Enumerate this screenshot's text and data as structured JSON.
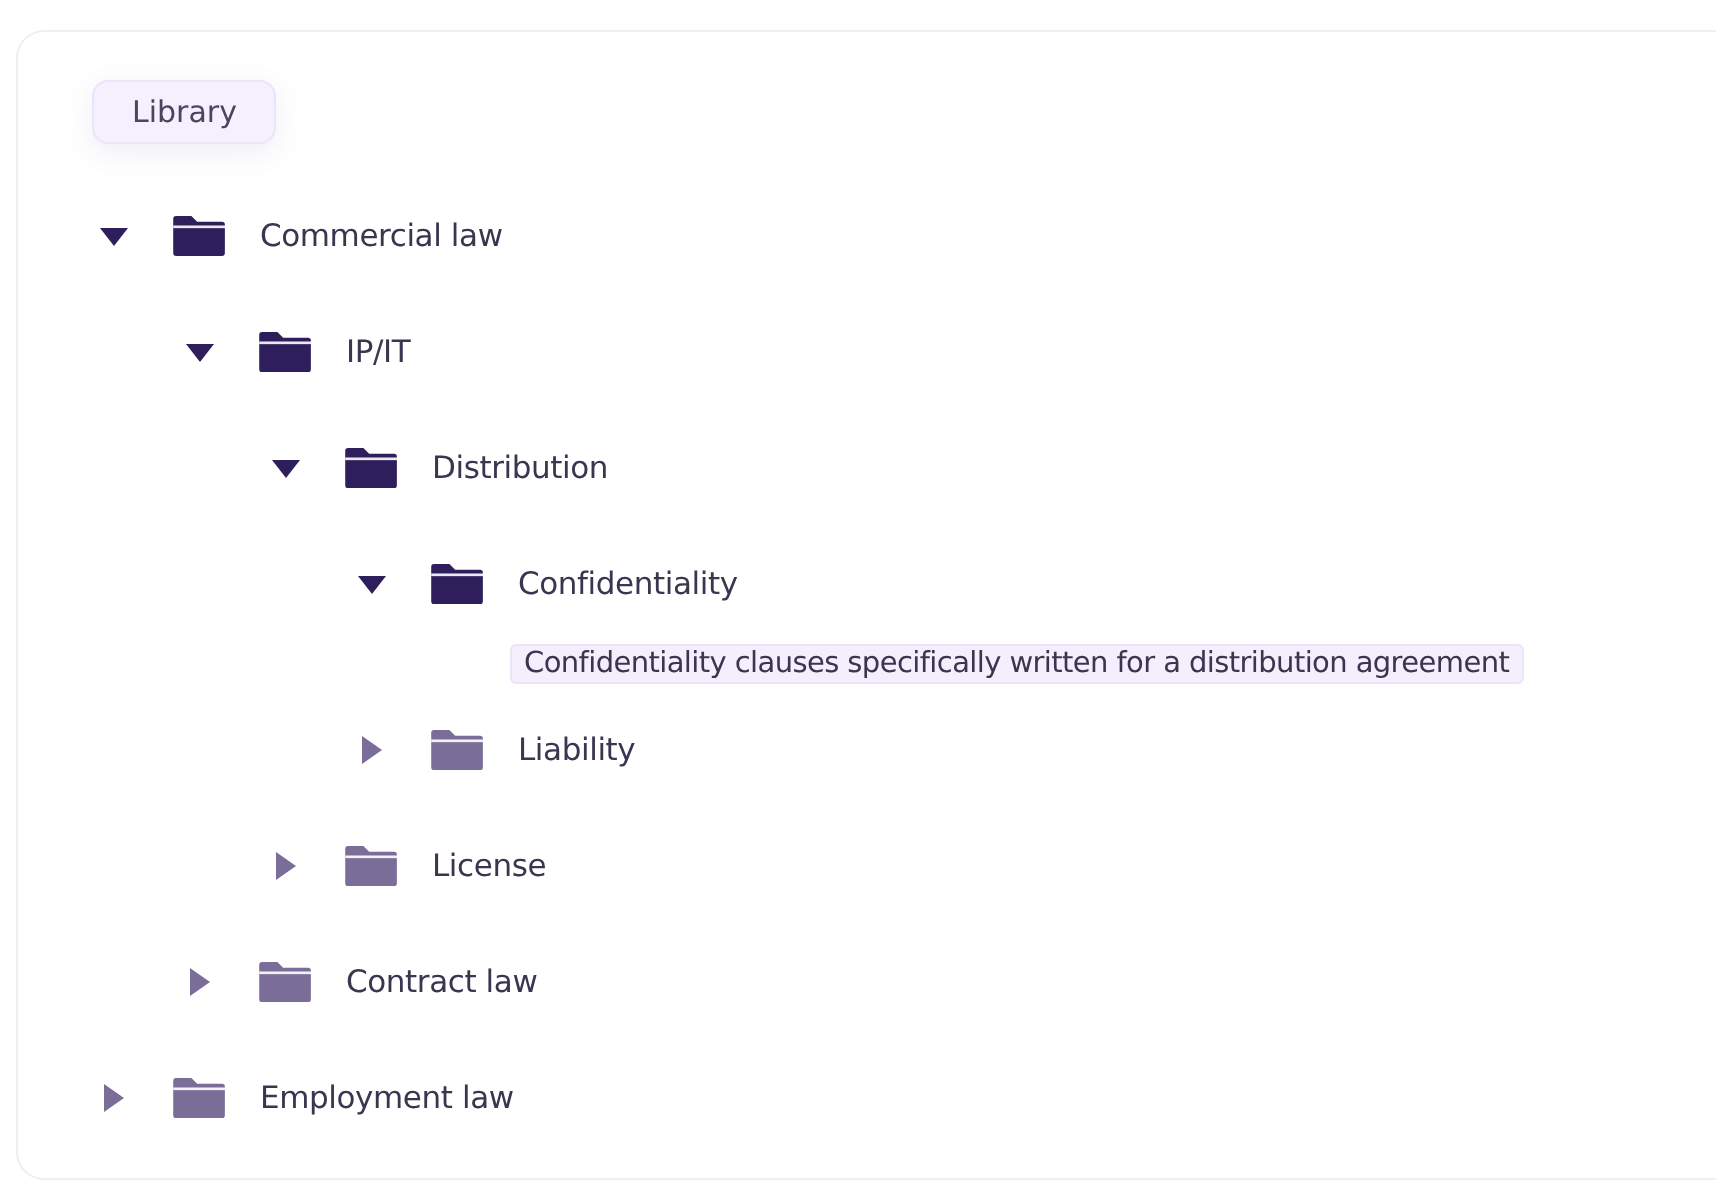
{
  "library_tab": {
    "label": "Library",
    "selected": true
  },
  "tree": [
    {
      "label": "Commercial law",
      "expanded": true,
      "children": [
        {
          "label": "IP/IT",
          "expanded": true,
          "children": [
            {
              "label": "Distribution",
              "expanded": true,
              "children": [
                {
                  "label": "Confidentiality",
                  "expanded": true,
                  "description": "Confidentiality clauses specifically written for a distribution agreement"
                },
                {
                  "label": "Liability",
                  "expanded": false
                }
              ]
            },
            {
              "label": "License",
              "expanded": false
            }
          ]
        },
        {
          "label": "Contract law",
          "expanded": false
        }
      ]
    },
    {
      "label": "Employment law",
      "expanded": false
    }
  ]
}
